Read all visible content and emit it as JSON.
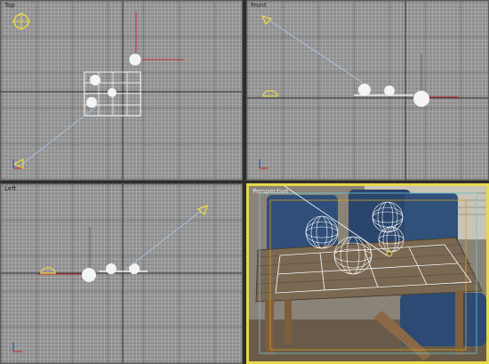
{
  "viewports": {
    "top": {
      "label": "Top"
    },
    "front": {
      "label": "Front"
    },
    "left": {
      "label": "Left"
    },
    "perspective": {
      "label": "Perspective"
    }
  },
  "colors": {
    "grid_bg": "#8e8e8e",
    "active_border": "#e8d94a",
    "light_gizmo": "#e8d94a",
    "axis_x": "#c83232",
    "axis_y": "#c83232",
    "target_line": "#a8c8e8",
    "wireframe": "#ffffff"
  },
  "icons": [
    "light-icon",
    "camera-target-icon",
    "axis-tripod-icon",
    "sphere-icon",
    "plane-grid-icon"
  ]
}
